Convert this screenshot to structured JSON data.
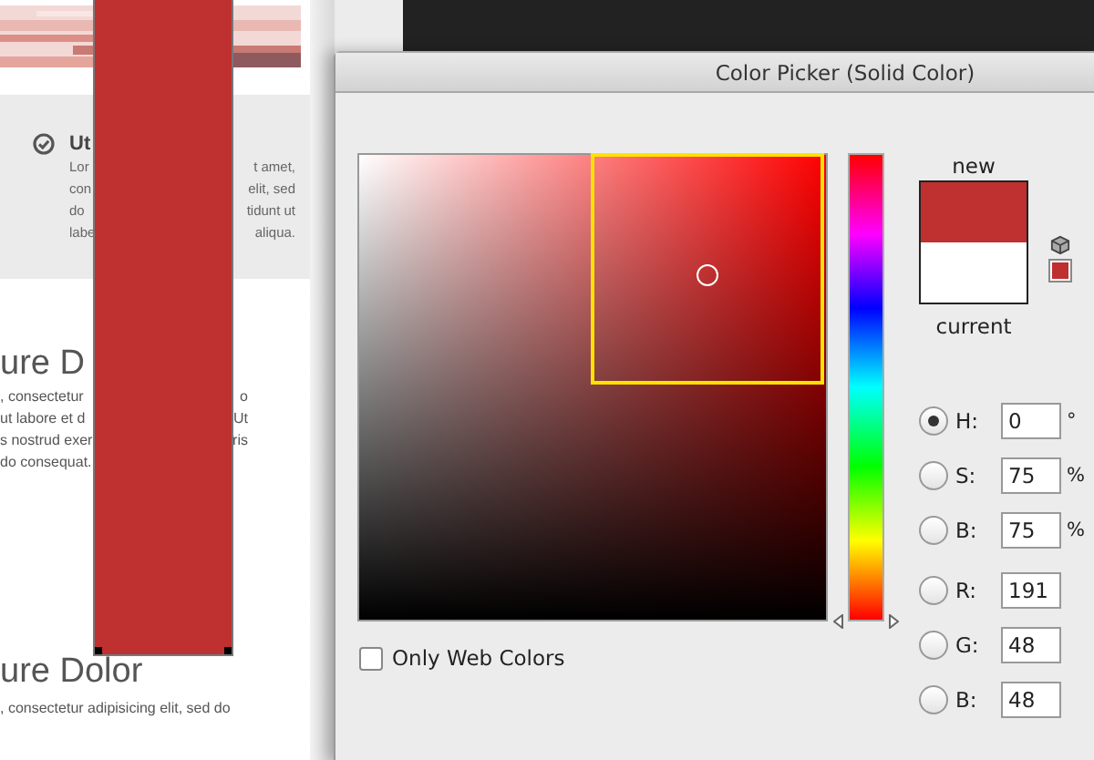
{
  "background_page": {
    "feature": {
      "title": "Ut",
      "lines": [
        {
          "left": "Lor",
          "right": "t amet,"
        },
        {
          "left": "con",
          "right": "elit, sed"
        },
        {
          "left": "do",
          "right": "tidunt ut"
        },
        {
          "left": "labe",
          "right": "aliqua."
        }
      ]
    },
    "sections": [
      {
        "heading": "ure D",
        "lines": [
          {
            "left": ", consectetur",
            "right": "o"
          },
          {
            "left": "ut labore et d",
            "right": "Ut"
          },
          {
            "left": "s nostrud exer",
            "right": "ris"
          },
          {
            "left": "do consequat."
          }
        ]
      },
      {
        "heading": "ure Dolor",
        "lines": [
          {
            "left": ", consectetur adipisicing elit, sed do"
          }
        ]
      }
    ]
  },
  "selection": {
    "color": "#bf3030"
  },
  "dialog": {
    "title": "Color Picker (Solid Color)",
    "new_label": "new",
    "current_label": "current",
    "hue_slider": {
      "level": 0
    },
    "fields": [
      {
        "label": "H:",
        "value": "0",
        "unit": "°",
        "selected": true
      },
      {
        "label": "S:",
        "value": "75",
        "unit": "%",
        "selected": false
      },
      {
        "label": "B:",
        "value": "75",
        "unit": "%",
        "selected": false
      },
      {
        "label": "R:",
        "value": "191",
        "selected": false
      },
      {
        "label": "G:",
        "value": "48",
        "selected": false
      },
      {
        "label": "B:",
        "value": "48",
        "selected": false
      }
    ],
    "web_colors": {
      "label": "Only Web Colors",
      "checked": false
    }
  }
}
